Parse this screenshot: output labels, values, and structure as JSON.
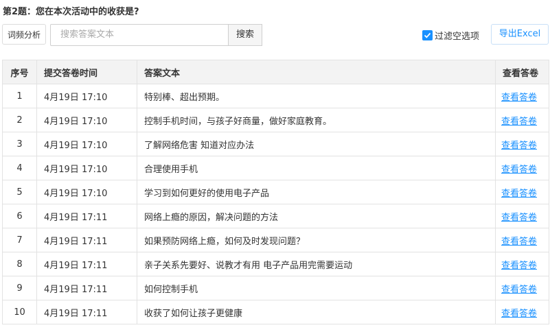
{
  "question_title": "第2题：您在本次活动中的收获是?",
  "toolbar": {
    "wordcloud_label": "词频分析",
    "search_placeholder": "搜索答案文本",
    "search_button": "搜索",
    "filter_label": "过滤空选项",
    "filter_checked": true,
    "export_label": "导出Excel"
  },
  "table": {
    "headers": [
      "序号",
      "提交答卷时间",
      "答案文本",
      "查看答卷"
    ],
    "rows": [
      {
        "no": "1",
        "time": "4月19日 17:10",
        "text": "特别棒、超出预期。",
        "link": "查看答卷"
      },
      {
        "no": "2",
        "time": "4月19日 17:10",
        "text": "控制手机时间，与孩子好商量，做好家庭教育。",
        "link": "查看答卷"
      },
      {
        "no": "3",
        "time": "4月19日 17:10",
        "text": "了解网络危害 知道对应办法",
        "link": "查看答卷"
      },
      {
        "no": "4",
        "time": "4月19日 17:10",
        "text": "合理使用手机",
        "link": "查看答卷"
      },
      {
        "no": "5",
        "time": "4月19日 17:10",
        "text": "学习到如何更好的使用电子产品",
        "link": "查看答卷"
      },
      {
        "no": "6",
        "time": "4月19日 17:11",
        "text": "网络上瘾的原因，解决问题的方法",
        "link": "查看答卷"
      },
      {
        "no": "7",
        "time": "4月19日 17:11",
        "text": "如果预防网络上瘾，如何及时发现问题？",
        "link": "查看答卷"
      },
      {
        "no": "8",
        "time": "4月19日 17:11",
        "text": "亲子关系先要好、说教才有用 电子产品用完需要运动",
        "link": "查看答卷"
      },
      {
        "no": "9",
        "time": "4月19日 17:11",
        "text": "如何控制手机",
        "link": "查看答卷"
      },
      {
        "no": "10",
        "time": "4月19日 17:11",
        "text": "收获了如何让孩子更健康",
        "link": "查看答卷"
      }
    ]
  },
  "colors": {
    "accent": "#1890ff",
    "header_bg": "#f3f3f3",
    "border": "#e2e2e2"
  }
}
